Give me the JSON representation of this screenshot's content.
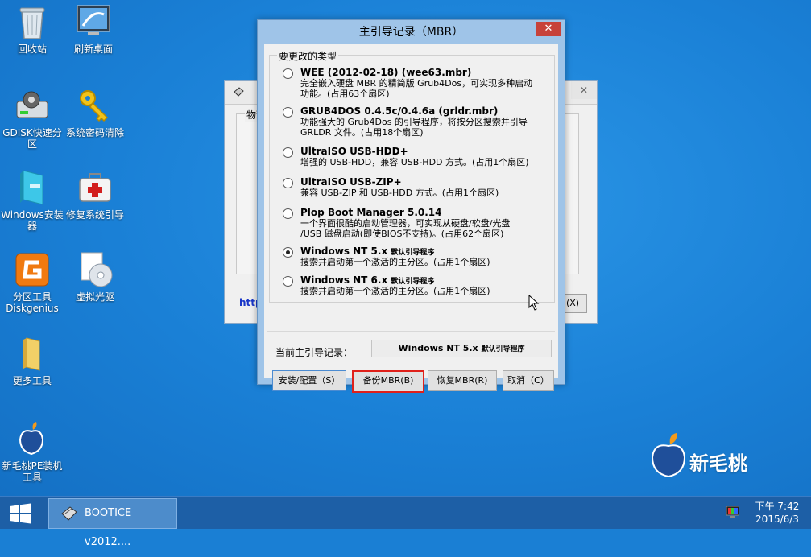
{
  "desktop": {
    "icons": [
      {
        "label": "回收站"
      },
      {
        "label": "刷新桌面"
      },
      {
        "label": "GDISK快速分区"
      },
      {
        "label": "系统密码清除"
      },
      {
        "label": "Windows安装器"
      },
      {
        "label": "修复系统引导"
      },
      {
        "label": "分区工具Diskgenius"
      },
      {
        "label": "虚拟光驱"
      },
      {
        "label": "更多工具"
      },
      {
        "label": "新毛桃PE装机工具"
      }
    ],
    "brand": "新毛桃"
  },
  "bg_window": {
    "close": "✕",
    "group_label": "物理",
    "link": "http",
    "button": "(X)"
  },
  "dialog": {
    "title": "主引导记录（MBR）",
    "close": "✕",
    "group_label": "要更改的类型",
    "options": [
      {
        "name": "WEE (2012-02-18) (wee63.mbr)",
        "tag": "",
        "desc": "完全嵌入硬盘 MBR 的精简版 Grub4Dos，可实现多种启动\n功能。(占用63个扇区)",
        "selected": false
      },
      {
        "name": "GRUB4DOS 0.4.5c/0.4.6a (grldr.mbr)",
        "tag": "",
        "desc": "功能强大的 Grub4Dos 的引导程序，将按分区搜索并引导\nGRLDR 文件。(占用18个扇区)",
        "selected": false
      },
      {
        "name": "UltraISO USB-HDD+",
        "tag": "",
        "desc": "增强的 USB-HDD，兼容 USB-HDD 方式。(占用1个扇区)",
        "selected": false
      },
      {
        "name": "UltraISO USB-ZIP+",
        "tag": "",
        "desc": "兼容 USB-ZIP 和 USB-HDD 方式。(占用1个扇区)",
        "selected": false
      },
      {
        "name": "Plop Boot Manager 5.0.14",
        "tag": "",
        "desc": "一个界面很酷的启动管理器，可实现从硬盘/软盘/光盘\n/USB 磁盘启动(即使BIOS不支持)。(占用62个扇区)",
        "selected": false
      },
      {
        "name": "Windows NT 5.x",
        "tag": "默认引导程序",
        "desc": "搜索并启动第一个激活的主分区。(占用1个扇区)",
        "selected": true
      },
      {
        "name": "Windows NT 6.x",
        "tag": "默认引导程序",
        "desc": "搜索并启动第一个激活的主分区。(占用1个扇区)",
        "selected": false
      }
    ],
    "current_label": "当前主引导记录：",
    "current_value": "Windows NT 5.x",
    "current_tag": "默认引导程序",
    "buttons": {
      "install": "安装/配置（S）",
      "backup": "备份MBR(B)",
      "restore": "恢复MBR(R)",
      "cancel": "取消（C）"
    }
  },
  "taskbar": {
    "task_label": "BOOTICE v2012....",
    "time": "下午 7:42",
    "date": "2015/6/3"
  }
}
